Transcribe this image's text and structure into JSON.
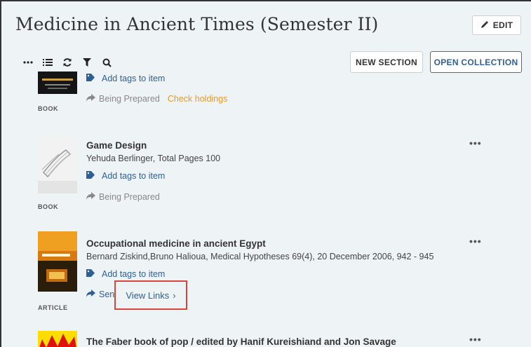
{
  "header": {
    "title": "Medicine in Ancient Times (Semester II)",
    "edit_label": "EDIT",
    "new_section_label": "NEW SECTION",
    "open_collection_label": "OPEN COLLECTION"
  },
  "toolbar": {
    "more_icon": "more-icon",
    "list_icon": "list-icon",
    "refresh_icon": "refresh-icon",
    "filter_icon": "filter-icon",
    "search_icon": "search-icon"
  },
  "items": [
    {
      "type": "BOOK",
      "tags_label": "Add tags to item",
      "status": "Being Prepared",
      "check_holdings": "Check holdings"
    },
    {
      "title": "Game Design",
      "meta": "Yehuda Berlinger, Total Pages 100",
      "tags_label": "Add tags to item",
      "status": "Being Prepared",
      "type": "BOOK"
    },
    {
      "title": "Occupational medicine in ancient Egypt",
      "meta": "Bernard Ziskind,Bruno Halioua, Medical Hypotheses 69(4), 20 December 2006, 942 - 945",
      "tags_label": "Add tags to item",
      "status": "Sent",
      "type": "ARTICLE",
      "view_links": "View Links",
      "view_links_chevron": "›"
    },
    {
      "title": "The Faber book of pop / edited by Hanif Kureishiand and Jon Savage"
    }
  ],
  "colors": {
    "background": "#eef3f5",
    "link": "#2f5f94",
    "accent_orange": "#e69a2e",
    "highlight_red": "#d9453b"
  }
}
